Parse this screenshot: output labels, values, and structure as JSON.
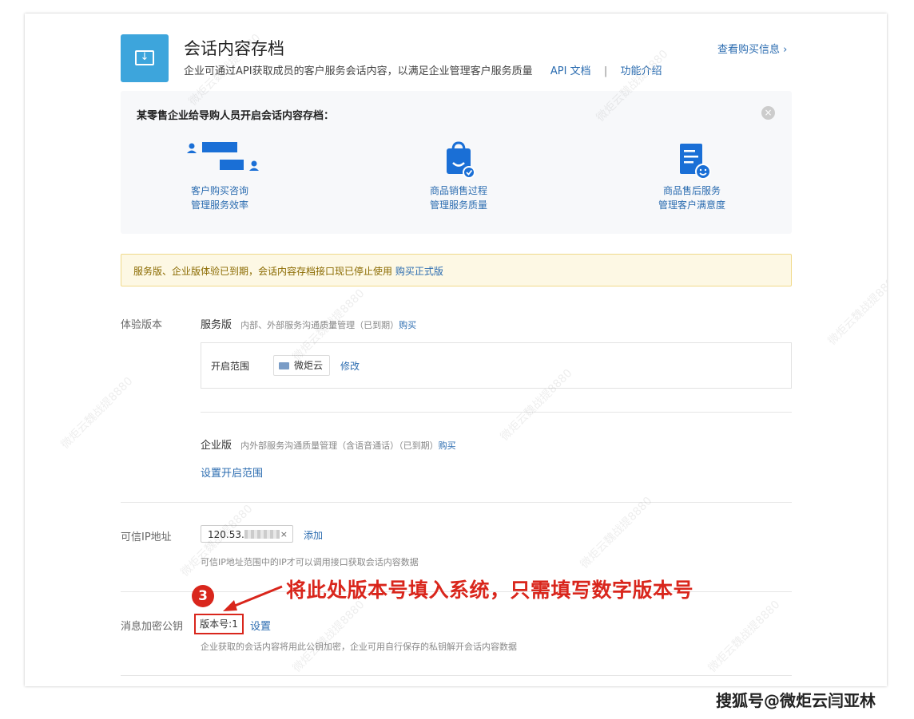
{
  "header": {
    "title": "会话内容存档",
    "subtitle": "企业可通过API获取成员的客户服务会话内容，以满足企业管理客户服务质量",
    "api_doc": "API 文档",
    "separator": "|",
    "features": "功能介绍",
    "purchase_info": "查看购买信息 ›"
  },
  "scenario": {
    "title": "某零售企业给导购人员开启会话内容存档：",
    "close_icon": "×",
    "items": [
      {
        "line1": "客户购买咨询",
        "line2": "管理服务效率",
        "icon": "chat-people-icon"
      },
      {
        "line1": "商品销售过程",
        "line2": "管理服务质量",
        "icon": "shopping-bag-icon"
      },
      {
        "line1": "商品售后服务",
        "line2": "管理客户满意度",
        "icon": "document-smile-icon"
      }
    ]
  },
  "notice": {
    "text": "服务版、企业版体验已到期，会话内容存档接口现已停止使用",
    "link": "购买正式版"
  },
  "trial": {
    "label": "体验版本",
    "service": {
      "name": "服务版",
      "desc": "内部、外部服务沟通质量管理（已到期）",
      "buy": "购买",
      "scope_label": "开启范围",
      "scope_value": "微炬云",
      "edit": "修改"
    },
    "enterprise": {
      "name": "企业版",
      "desc": "内外部服务沟通质量管理（含语音通话）（已到期）",
      "buy": "购买",
      "set_scope": "设置开启范围"
    }
  },
  "ip": {
    "label": "可信IP地址",
    "value": "120.53.",
    "clear": "×",
    "add": "添加",
    "hint": "可信IP地址范围中的IP才可以调用接口获取会话内容数据"
  },
  "key": {
    "label": "消息加密公钥",
    "version": "版本号:1",
    "setup": "设置",
    "hint": "企业获取的会话内容将用此公钥加密，企业可用自行保存的私钥解开会话内容数据"
  },
  "annotation": {
    "badge": "3",
    "text": "将此处版本号填入系统，只需填写数字版本号"
  },
  "credit": "搜狐号@微炬云闫亚林",
  "watermark": "微炬云魏战提8880",
  "colors": {
    "accent": "#2b6cb0",
    "icon_blue": "#3da5dc",
    "annotation_red": "#d9261c",
    "notice_bg": "#fdf8e4"
  }
}
